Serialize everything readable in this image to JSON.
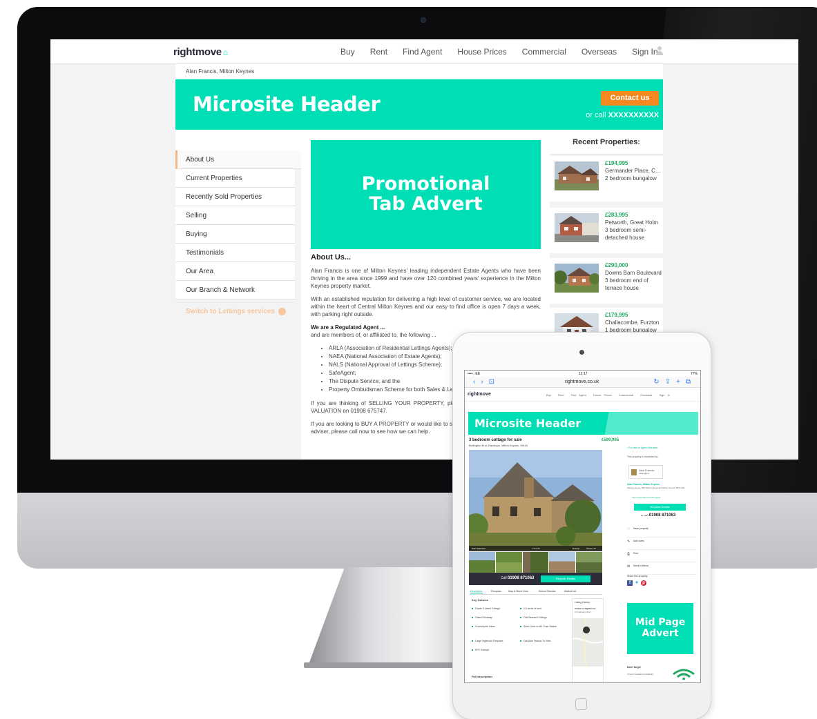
{
  "desktop": {
    "nav": {
      "logo": "rightmove",
      "links": [
        "Buy",
        "Rent",
        "Find Agent",
        "House Prices",
        "Commercial",
        "Overseas",
        "Sign In"
      ]
    },
    "breadcrumb": "Alan Francis, Milton Keynes",
    "header": {
      "title": "Microsite Header",
      "contact_label": "Contact us",
      "or_call": "or call",
      "phone": "XXXXXXXXXX"
    },
    "menu": [
      "About Us",
      "Current Properties",
      "Recently Sold Properties",
      "Selling",
      "Buying",
      "Testimonials",
      "Our Area",
      "Our Branch & Network"
    ],
    "switch_lettings": "Switch to Lettings services",
    "promo": {
      "line1": "Promotional",
      "line2": "Tab Advert"
    },
    "about": {
      "title": "About Us...",
      "p1": "Alan Francis is one of Milton Keynes' leading independent Estate Agents who have been thriving in the area since 1999 and have over 120 combined years' experience in the Milton Keynes property market.",
      "p2": "With an established reputation for delivering a high level of customer service, we are located within the heart of Central Milton Keynes and our easy to find office is open 7 days a week, with parking right outside.",
      "reg_title": "We are a Regulated Agent ...",
      "reg_sub": "and are members of, or affiliated to, the following ...",
      "list": [
        "ARLA (Association of Residential Lettings Agents);",
        "NAEA (National Association of Estate Agents);",
        "NALS (National Approval of Lettings Scheme);",
        "SafeAgent;",
        "The Dispute Service; and the",
        "Property Ombudsman Scheme for both Sales & Lettings."
      ],
      "p3": "If you are thinking of SELLING YOUR PROPERTY, please call now to arrange a FREE VALUATION on 01908 675747.",
      "p4": "If you are looking to BUY A PROPERTY or would like to speak with an independent mortgage adviser, please call now to see how we can help."
    },
    "recent": {
      "title": "Recent Properties:",
      "items": [
        {
          "price": "£194,995",
          "addr": "Germander Place, Conniburrow",
          "desc": "2 bedroom bungalow"
        },
        {
          "price": "£283,995",
          "addr": "Petworth, Great Holm",
          "desc": "3 bedroom semi-detached house"
        },
        {
          "price": "£290,000",
          "addr": "Downs Barn Boulevard",
          "desc": "3 bedroom end of terrace house"
        },
        {
          "price": "£179,995",
          "addr": "Challacombe, Furzton",
          "desc": "1 bedroom bungalow"
        }
      ]
    }
  },
  "tablet": {
    "status": {
      "left": "••••○ EE",
      "time": "12:17",
      "battery": "77%"
    },
    "url": "rightmove.co.uk",
    "logo": "rightmove",
    "links": [
      "Buy",
      "Rent",
      "Find Agent",
      "House Prices",
      "Commercial",
      "Overseas",
      "Sign In"
    ],
    "header": "Microsite Header",
    "property_title": "3 bedroom cottage for sale",
    "price": "£599,995",
    "address": "Bullington End, Hanslope, Milton Keynes, MK19",
    "slideshow": "Start slideshow",
    "pic_count": "19 of 21",
    "enlarge": "Enlarge",
    "picture": "Picture 19",
    "call_label": "Call",
    "call_phone": "01908 871063",
    "request_details": "Request Details",
    "tabs": [
      "Description",
      "Floorplan",
      "Map & Street View",
      "School Checker",
      "Market Info"
    ],
    "key_features_title": "Key features",
    "features": [
      "Grade II Listed Cottage",
      "1.6 acres of land",
      "Gated Driveway",
      "Oak Beamed Ceilings",
      "Countryside Views",
      "Short Drive to MK Train Station",
      "Large Inglenook Fireplace",
      "Call Alan Francis To View",
      "EPC Exempt"
    ],
    "full_description": "Full description",
    "history_title": "Listing History",
    "history_added": "Added on Rightmove:",
    "history_date": "07 February 2017",
    "back_link": "Go back to Agent Microsite",
    "marketed_by": "This property is marketed by:",
    "agent_logo": "Alan Francis",
    "agent_logo_sub": "estate agents",
    "agent_name": "Alan Francis, Milton Keynes",
    "agent_address": "Marlow House, 358 Silbury Boulevard Milton Keynes MK9 2AE",
    "view_props": "View properties from this agent",
    "or_call": "or call",
    "agent_phone": "01908 871063",
    "actions": [
      "Save property",
      "Add notes",
      "Print",
      "Send to friend"
    ],
    "share_title": "Share this property",
    "mid_advert": {
      "line1": "Mid Page",
      "line2": "Advert"
    },
    "dont_forget": "Don't forget",
    "broadband": "Check broadband availability",
    "colors": {
      "accent": "#00deb6",
      "price": "#22a862",
      "contact": "#f5891f"
    }
  }
}
